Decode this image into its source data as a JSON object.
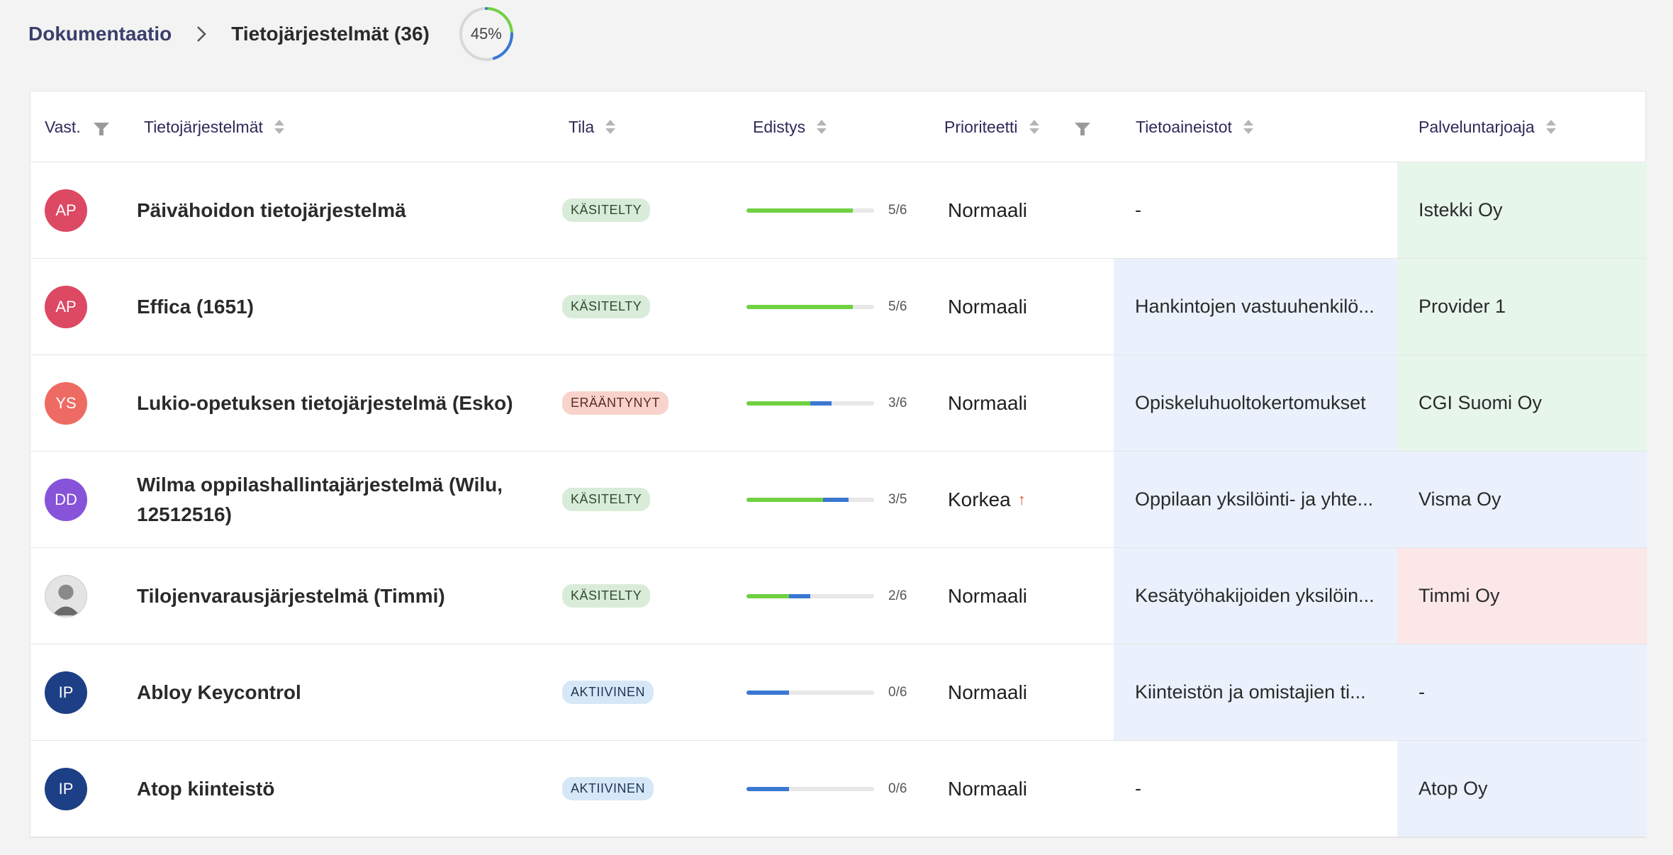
{
  "breadcrumb": {
    "root": "Dokumentaatio",
    "current": "Tietojärjestelmät (36)",
    "progress_label": "45%",
    "progress_value": 0.45
  },
  "columns": {
    "owner": "Vast.",
    "system": "Tietojärjestelmät",
    "status": "Tila",
    "progress": "Edistys",
    "priority": "Prioriteetti",
    "datasets": "Tietoaineistot",
    "provider": "Palveluntarjoaja"
  },
  "colors": {
    "status": {
      "KÄSITELTY": {
        "bg": "#d9ecd9",
        "fg": "#2f4a2f"
      },
      "ERÄÄNTYNYT": {
        "bg": "#f8d3cc",
        "fg": "#5a2a22"
      },
      "AKTIIVINEN": {
        "bg": "#d6e8f8",
        "fg": "#1f3550"
      }
    },
    "progress_done": "#6fd141",
    "progress_active": "#3a78d2",
    "priority_up": "#e0533e"
  },
  "rows": [
    {
      "initials": "AP",
      "avatar_color": "#dd4863",
      "name": "Päivähoidon tietojärjestelmä",
      "status": "KÄSITELTY",
      "done": 5,
      "active": 0,
      "total": 6,
      "progress": "5/6",
      "priority": "Normaali",
      "priority_up": false,
      "datasets": "-",
      "datasets_bg": "white",
      "provider": "Istekki Oy",
      "provider_bg": "green"
    },
    {
      "initials": "AP",
      "avatar_color": "#dd4863",
      "name": "Effica (1651)",
      "status": "KÄSITELTY",
      "done": 5,
      "active": 0,
      "total": 6,
      "progress": "5/6",
      "priority": "Normaali",
      "priority_up": false,
      "datasets": "Hankintojen vastuuhenkilö...",
      "datasets_bg": "blue",
      "provider": "Provider 1",
      "provider_bg": "green"
    },
    {
      "initials": "YS",
      "avatar_color": "#ee6b63",
      "name": "Lukio-opetuksen tietojärjestelmä (Esko)",
      "status": "ERÄÄNTYNYT",
      "done": 3,
      "active": 1,
      "total": 6,
      "progress": "3/6",
      "priority": "Normaali",
      "priority_up": false,
      "datasets": "Opiskeluhuoltokertomukset",
      "datasets_bg": "blue",
      "provider": "CGI Suomi Oy",
      "provider_bg": "green"
    },
    {
      "initials": "DD",
      "avatar_color": "#8653d9",
      "name": "Wilma oppilashallintajärjestelmä (Wilu, 12512516)",
      "status": "KÄSITELTY",
      "done": 3,
      "active": 1,
      "total": 5,
      "progress": "3/5",
      "priority": "Korkea",
      "priority_up": true,
      "datasets": "Oppilaan yksilöinti- ja yhte...",
      "datasets_bg": "blue",
      "provider": "Visma Oy",
      "provider_bg": "blue"
    },
    {
      "initials": "",
      "avatar_color": "#dcdcdc",
      "photo": true,
      "name": "Tilojenvarausjärjestelmä (Timmi)",
      "status": "KÄSITELTY",
      "done": 2,
      "active": 1,
      "total": 6,
      "progress": "2/6",
      "priority": "Normaali",
      "priority_up": false,
      "datasets": "Kesätyöhakijoiden yksilöin...",
      "datasets_bg": "blue",
      "provider": "Timmi Oy",
      "provider_bg": "red"
    },
    {
      "initials": "IP",
      "avatar_color": "#1d3f86",
      "name": "Abloy Keycontrol",
      "status": "AKTIIVINEN",
      "done": 0,
      "active": 2,
      "total": 6,
      "progress": "0/6",
      "priority": "Normaali",
      "priority_up": false,
      "datasets": "Kiinteistön ja omistajien ti...",
      "datasets_bg": "blue",
      "provider": "-",
      "provider_bg": "blue"
    },
    {
      "initials": "IP",
      "avatar_color": "#1d3f86",
      "name": "Atop kiinteistö",
      "status": "AKTIIVINEN",
      "done": 0,
      "active": 2,
      "total": 6,
      "progress": "0/6",
      "priority": "Normaali",
      "priority_up": false,
      "datasets": "-",
      "datasets_bg": "white",
      "provider": "Atop Oy",
      "provider_bg": "blue"
    }
  ]
}
